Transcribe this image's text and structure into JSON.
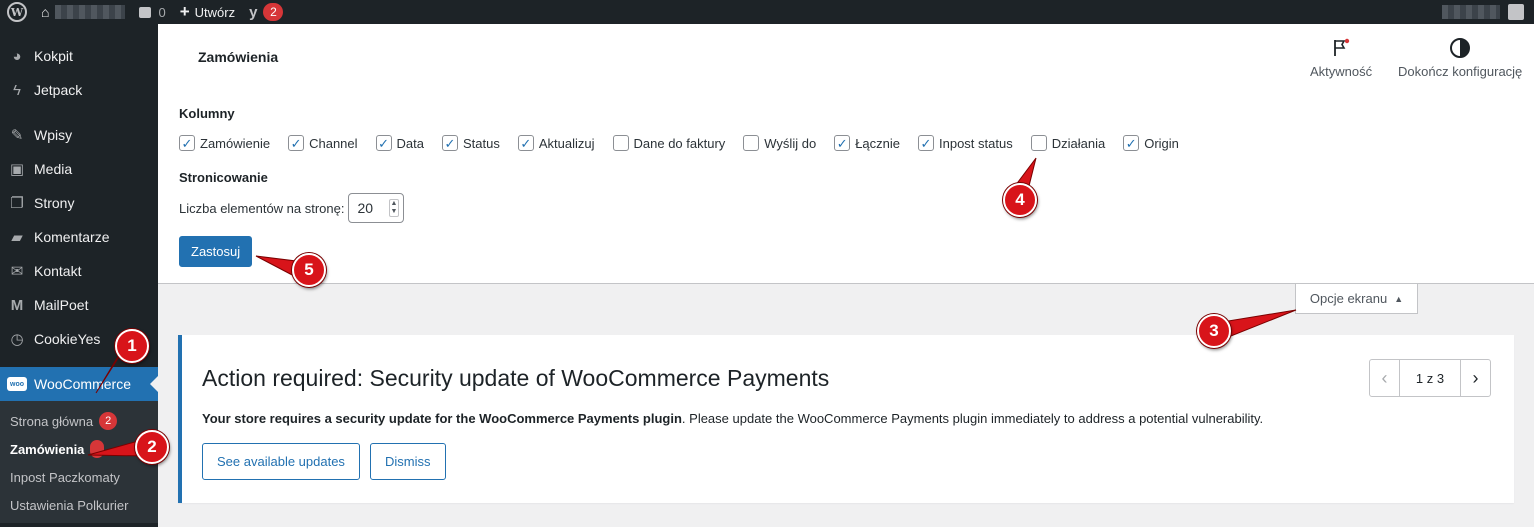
{
  "admin_bar": {
    "comments_count": "0",
    "new_label": "Utwórz",
    "yoast_count": "2"
  },
  "sidebar": {
    "items": [
      {
        "label": "Kokpit",
        "icon": "dashboard-icon"
      },
      {
        "label": "Jetpack",
        "icon": "jetpack-icon"
      },
      {
        "label": "Wpisy",
        "icon": "pin-icon"
      },
      {
        "label": "Media",
        "icon": "media-icon"
      },
      {
        "label": "Strony",
        "icon": "pages-icon"
      },
      {
        "label": "Komentarze",
        "icon": "comments-icon"
      },
      {
        "label": "Kontakt",
        "icon": "mail-icon"
      },
      {
        "label": "MailPoet",
        "icon": "mailpoet-icon"
      },
      {
        "label": "CookieYes",
        "icon": "cookieyes-icon"
      },
      {
        "label": "WooCommerce",
        "icon": "woocommerce-icon"
      }
    ],
    "submenu": [
      {
        "label": "Strona główna",
        "badge": "2"
      },
      {
        "label": "Zamówienia",
        "badge": ""
      },
      {
        "label": "Inpost Paczkomaty"
      },
      {
        "label": "Ustawienia Polkurier"
      }
    ]
  },
  "header": {
    "title": "Zamówienia",
    "activity_label": "Aktywność",
    "setup_label": "Dokończ konfigurację"
  },
  "screen_options": {
    "columns_heading": "Kolumny",
    "columns": [
      {
        "label": "Zamówienie",
        "checked": true
      },
      {
        "label": "Channel",
        "checked": true
      },
      {
        "label": "Data",
        "checked": true
      },
      {
        "label": "Status",
        "checked": true
      },
      {
        "label": "Aktualizuj",
        "checked": true
      },
      {
        "label": "Dane do faktury",
        "checked": false
      },
      {
        "label": "Wyślij do",
        "checked": false
      },
      {
        "label": "Łącznie",
        "checked": true
      },
      {
        "label": "Inpost status",
        "checked": true
      },
      {
        "label": "Działania",
        "checked": false
      },
      {
        "label": "Origin",
        "checked": true
      }
    ],
    "pagination_heading": "Stronicowanie",
    "per_page_label": "Liczba elementów na stronę:",
    "per_page_value": "20",
    "apply_label": "Zastosuj",
    "toggle_label": "Opcje ekranu"
  },
  "notice": {
    "title": "Action required: Security update of WooCommerce Payments",
    "body_bold": "Your store requires a security update for the WooCommerce Payments plugin",
    "body_rest": ". Please update the WooCommerce Payments plugin immediately to address a potential vulnerability.",
    "primary_label": "See available updates",
    "dismiss_label": "Dismiss",
    "pager_label": "1 z 3"
  },
  "annotations": [
    "1",
    "2",
    "3",
    "4",
    "5"
  ],
  "colors": {
    "admin_dark": "#1d2327",
    "accent": "#2271b1",
    "badge": "#d63638",
    "marker": "#d8141a"
  }
}
